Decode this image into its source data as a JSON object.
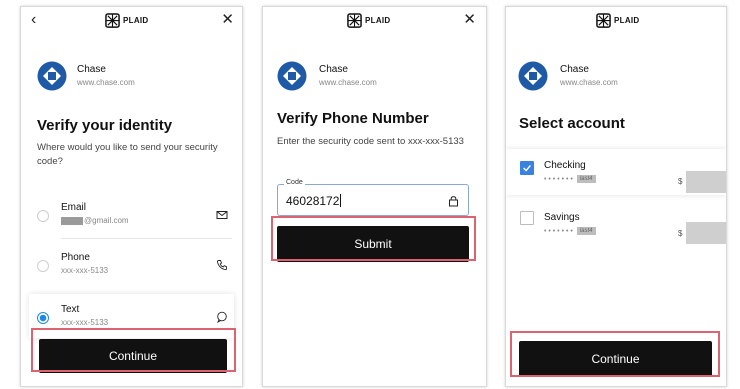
{
  "brand": "PLAID",
  "bank": {
    "name": "Chase",
    "url": "www.chase.com"
  },
  "panel1": {
    "title": "Verify your identity",
    "prompt": "Where would you like to send your security code?",
    "options": [
      {
        "title": "Email",
        "sub": "@gmail.com",
        "icon": "mail-icon",
        "selected": false
      },
      {
        "title": "Phone",
        "sub": "xxx-xxx-5133",
        "icon": "phone-icon",
        "selected": false
      },
      {
        "title": "Text",
        "sub": "xxx-xxx-5133",
        "icon": "chat-bubble-icon",
        "selected": true
      }
    ],
    "button": "Continue"
  },
  "panel2": {
    "title": "Verify Phone Number",
    "prompt": "Enter the security code sent to xxx-xxx-5133",
    "code_label": "Code",
    "code_value": "46028172",
    "button": "Submit"
  },
  "panel3": {
    "title": "Select account",
    "accounts": [
      {
        "name": "Checking",
        "mask": "• • • • • • •",
        "last4": "last4",
        "currency": "$",
        "checked": true
      },
      {
        "name": "Savings",
        "mask": "• • • • • • •",
        "last4": "last4",
        "currency": "$",
        "checked": false
      }
    ],
    "button": "Continue"
  },
  "colors": {
    "button_bg": "#111111",
    "highlight": "#dc6470",
    "selected_blue": "#1e88e5",
    "checkbox_blue": "#3b82e0"
  }
}
